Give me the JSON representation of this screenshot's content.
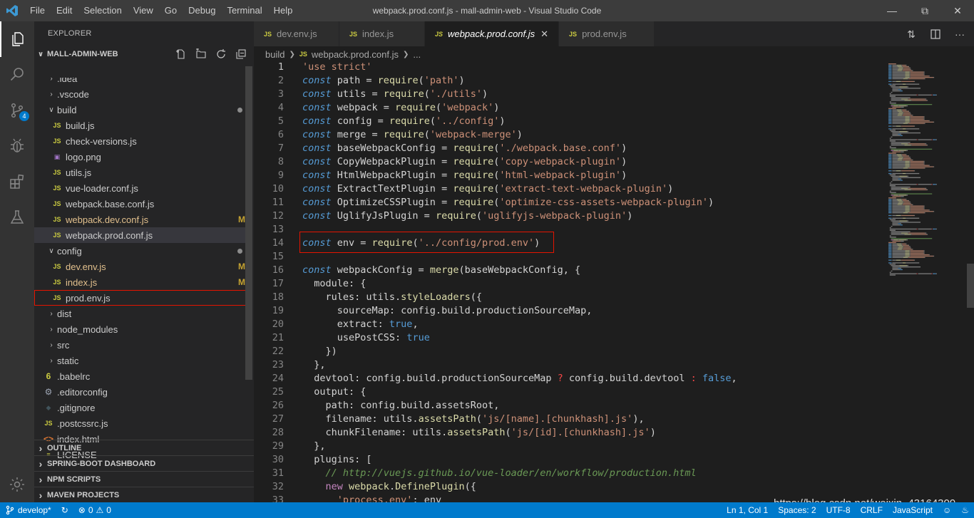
{
  "window": {
    "title": "webpack.prod.conf.js - mall-admin-web - Visual Studio Code",
    "menu": [
      "File",
      "Edit",
      "Selection",
      "View",
      "Go",
      "Debug",
      "Terminal",
      "Help"
    ]
  },
  "activity_bar": {
    "icons": [
      "explorer-icon",
      "search-icon",
      "source-control-icon",
      "debug-icon",
      "extensions-icon",
      "test-icon"
    ],
    "scm_badge": "4",
    "settings_icon": "gear-icon"
  },
  "sidebar": {
    "header": "EXPLORER",
    "project": "MALL-ADMIN-WEB",
    "tree": [
      {
        "label": ".idea",
        "type": "folder",
        "depth": 0
      },
      {
        "label": ".vscode",
        "type": "folder",
        "depth": 0
      },
      {
        "label": "build",
        "type": "folder-open",
        "depth": 0,
        "dot": true
      },
      {
        "label": "build.js",
        "type": "js",
        "depth": 1
      },
      {
        "label": "check-versions.js",
        "type": "js",
        "depth": 1
      },
      {
        "label": "logo.png",
        "type": "img",
        "depth": 1
      },
      {
        "label": "utils.js",
        "type": "js",
        "depth": 1
      },
      {
        "label": "vue-loader.conf.js",
        "type": "js",
        "depth": 1
      },
      {
        "label": "webpack.base.conf.js",
        "type": "js",
        "depth": 1
      },
      {
        "label": "webpack.dev.conf.js",
        "type": "js",
        "depth": 1,
        "status": "M"
      },
      {
        "label": "webpack.prod.conf.js",
        "type": "js",
        "depth": 1,
        "selected": true
      },
      {
        "label": "config",
        "type": "folder-open",
        "depth": 0,
        "dot": true
      },
      {
        "label": "dev.env.js",
        "type": "js",
        "depth": 1,
        "status": "M"
      },
      {
        "label": "index.js",
        "type": "js",
        "depth": 1,
        "status": "M"
      },
      {
        "label": "prod.env.js",
        "type": "js",
        "depth": 1,
        "highlight": true
      },
      {
        "label": "dist",
        "type": "folder",
        "depth": 0
      },
      {
        "label": "node_modules",
        "type": "folder",
        "depth": 0
      },
      {
        "label": "src",
        "type": "folder",
        "depth": 0
      },
      {
        "label": "static",
        "type": "folder",
        "depth": 0
      },
      {
        "label": ".babelrc",
        "type": "babel",
        "depth": -1
      },
      {
        "label": ".editorconfig",
        "type": "gear",
        "depth": -1
      },
      {
        "label": ".gitignore",
        "type": "git",
        "depth": -1
      },
      {
        "label": ".postcssrc.js",
        "type": "js",
        "depth": -1
      },
      {
        "label": "index.html",
        "type": "html",
        "depth": -1
      },
      {
        "label": "LICENSE",
        "type": "lic",
        "depth": -1
      }
    ],
    "sections": [
      "OUTLINE",
      "SPRING-BOOT DASHBOARD",
      "NPM SCRIPTS",
      "MAVEN PROJECTS"
    ]
  },
  "tabs": [
    {
      "label": "dev.env.js",
      "active": false
    },
    {
      "label": "index.js",
      "active": false
    },
    {
      "label": "webpack.prod.conf.js",
      "active": true
    },
    {
      "label": "prod.env.js",
      "active": false
    }
  ],
  "tab_icon_text": "JS",
  "breadcrumb": {
    "folder": "build",
    "file": "webpack.prod.conf.js",
    "more": "..."
  },
  "code_lines": [
    [
      [
        "str",
        "'use strict'"
      ]
    ],
    [
      [
        "kw",
        "const"
      ],
      [
        "op",
        " path = "
      ],
      [
        "fn",
        "require"
      ],
      [
        "op",
        "("
      ],
      [
        "str",
        "'path'"
      ],
      [
        "op",
        ")"
      ]
    ],
    [
      [
        "kw",
        "const"
      ],
      [
        "op",
        " utils = "
      ],
      [
        "fn",
        "require"
      ],
      [
        "op",
        "("
      ],
      [
        "str",
        "'./utils'"
      ],
      [
        "op",
        ")"
      ]
    ],
    [
      [
        "kw",
        "const"
      ],
      [
        "op",
        " webpack = "
      ],
      [
        "fn",
        "require"
      ],
      [
        "op",
        "("
      ],
      [
        "str",
        "'webpack'"
      ],
      [
        "op",
        ")"
      ]
    ],
    [
      [
        "kw",
        "const"
      ],
      [
        "op",
        " config = "
      ],
      [
        "fn",
        "require"
      ],
      [
        "op",
        "("
      ],
      [
        "str",
        "'../config'"
      ],
      [
        "op",
        ")"
      ]
    ],
    [
      [
        "kw",
        "const"
      ],
      [
        "op",
        " merge = "
      ],
      [
        "fn",
        "require"
      ],
      [
        "op",
        "("
      ],
      [
        "str",
        "'webpack-merge'"
      ],
      [
        "op",
        ")"
      ]
    ],
    [
      [
        "kw",
        "const"
      ],
      [
        "op",
        " baseWebpackConfig = "
      ],
      [
        "fn",
        "require"
      ],
      [
        "op",
        "("
      ],
      [
        "str",
        "'./webpack.base.conf'"
      ],
      [
        "op",
        ")"
      ]
    ],
    [
      [
        "kw",
        "const"
      ],
      [
        "op",
        " CopyWebpackPlugin = "
      ],
      [
        "fn",
        "require"
      ],
      [
        "op",
        "("
      ],
      [
        "str",
        "'copy-webpack-plugin'"
      ],
      [
        "op",
        ")"
      ]
    ],
    [
      [
        "kw",
        "const"
      ],
      [
        "op",
        " HtmlWebpackPlugin = "
      ],
      [
        "fn",
        "require"
      ],
      [
        "op",
        "("
      ],
      [
        "str",
        "'html-webpack-plugin'"
      ],
      [
        "op",
        ")"
      ]
    ],
    [
      [
        "kw",
        "const"
      ],
      [
        "op",
        " ExtractTextPlugin = "
      ],
      [
        "fn",
        "require"
      ],
      [
        "op",
        "("
      ],
      [
        "str",
        "'extract-text-webpack-plugin'"
      ],
      [
        "op",
        ")"
      ]
    ],
    [
      [
        "kw",
        "const"
      ],
      [
        "op",
        " OptimizeCSSPlugin = "
      ],
      [
        "fn",
        "require"
      ],
      [
        "op",
        "("
      ],
      [
        "str",
        "'optimize-css-assets-webpack-plugin'"
      ],
      [
        "op",
        ")"
      ]
    ],
    [
      [
        "kw",
        "const"
      ],
      [
        "op",
        " UglifyJsPlugin = "
      ],
      [
        "fn",
        "require"
      ],
      [
        "op",
        "("
      ],
      [
        "str",
        "'uglifyjs-webpack-plugin'"
      ],
      [
        "op",
        ")"
      ]
    ],
    [],
    [
      [
        "kw",
        "const"
      ],
      [
        "op",
        " env = "
      ],
      [
        "fn",
        "require"
      ],
      [
        "op",
        "("
      ],
      [
        "str",
        "'../config/prod.env'"
      ],
      [
        "op",
        ")"
      ]
    ],
    [],
    [
      [
        "kw",
        "const"
      ],
      [
        "op",
        " webpackConfig = "
      ],
      [
        "fn",
        "merge"
      ],
      [
        "op",
        "(baseWebpackConfig, {"
      ]
    ],
    [
      [
        "op",
        "  module: {"
      ]
    ],
    [
      [
        "op",
        "    rules: utils."
      ],
      [
        "fn",
        "styleLoaders"
      ],
      [
        "op",
        "({"
      ]
    ],
    [
      [
        "op",
        "      sourceMap: config.build.productionSourceMap,"
      ]
    ],
    [
      [
        "op",
        "      extract: "
      ],
      [
        "bool",
        "true"
      ],
      [
        "op",
        ","
      ]
    ],
    [
      [
        "op",
        "      usePostCSS: "
      ],
      [
        "bool",
        "true"
      ]
    ],
    [
      [
        "op",
        "    })"
      ]
    ],
    [
      [
        "op",
        "  },"
      ]
    ],
    [
      [
        "op",
        "  devtool: config.build.productionSourceMap "
      ],
      [
        "red",
        "?"
      ],
      [
        "op",
        " config.build.devtool "
      ],
      [
        "red",
        ":"
      ],
      [
        "op",
        " "
      ],
      [
        "bool",
        "false"
      ],
      [
        "op",
        ","
      ]
    ],
    [
      [
        "op",
        "  output: {"
      ]
    ],
    [
      [
        "op",
        "    path: config.build.assetsRoot,"
      ]
    ],
    [
      [
        "op",
        "    filename: utils."
      ],
      [
        "fn",
        "assetsPath"
      ],
      [
        "op",
        "("
      ],
      [
        "str",
        "'js/[name].[chunkhash].js'"
      ],
      [
        "op",
        "),"
      ]
    ],
    [
      [
        "op",
        "    chunkFilename: utils."
      ],
      [
        "fn",
        "assetsPath"
      ],
      [
        "op",
        "("
      ],
      [
        "str",
        "'js/[id].[chunkhash].js'"
      ],
      [
        "op",
        ")"
      ]
    ],
    [
      [
        "op",
        "  },"
      ]
    ],
    [
      [
        "op",
        "  plugins: ["
      ]
    ],
    [
      [
        "cmt",
        "    // http://vuejs.github.io/vue-loader/en/workflow/production.html"
      ]
    ],
    [
      [
        "new",
        "    new "
      ],
      [
        "fn",
        "webpack"
      ],
      [
        "op",
        "."
      ],
      [
        "fn",
        "DefinePlugin"
      ],
      [
        "op",
        "({"
      ]
    ],
    [
      [
        "str",
        "      'process.env'"
      ],
      [
        "op",
        ": env"
      ]
    ]
  ],
  "status": {
    "branch": "develop*",
    "errors": "0",
    "warnings": "0",
    "position": "Ln 1, Col 1",
    "spaces": "Spaces: 2",
    "encoding": "UTF-8",
    "eol": "CRLF",
    "language": "JavaScript"
  },
  "watermark": "https://blog.csdn.net/weixin_43164309",
  "colors": {
    "accent": "#007acc",
    "highlight_box": "#e51400"
  }
}
